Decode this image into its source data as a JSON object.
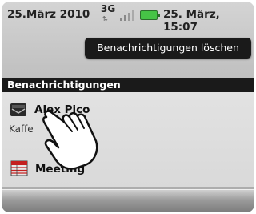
{
  "status_bar": {
    "date_left": "25.März 2010",
    "network": "3G",
    "network_arrows": "⇅",
    "date_time_right": "25. März, 15:07",
    "battery_color": "#46c446"
  },
  "clear_button": {
    "label": "Benachrichtigungen löschen"
  },
  "section": {
    "title": "Benachrichtigungen"
  },
  "notifications": [
    {
      "icon": "mail-icon",
      "title": "Alex Pico",
      "subtitle": "Kaffe"
    },
    {
      "icon": "calendar-icon",
      "title": "Meeting"
    }
  ],
  "overlay": {
    "icon": "hand-pointer-icon"
  }
}
